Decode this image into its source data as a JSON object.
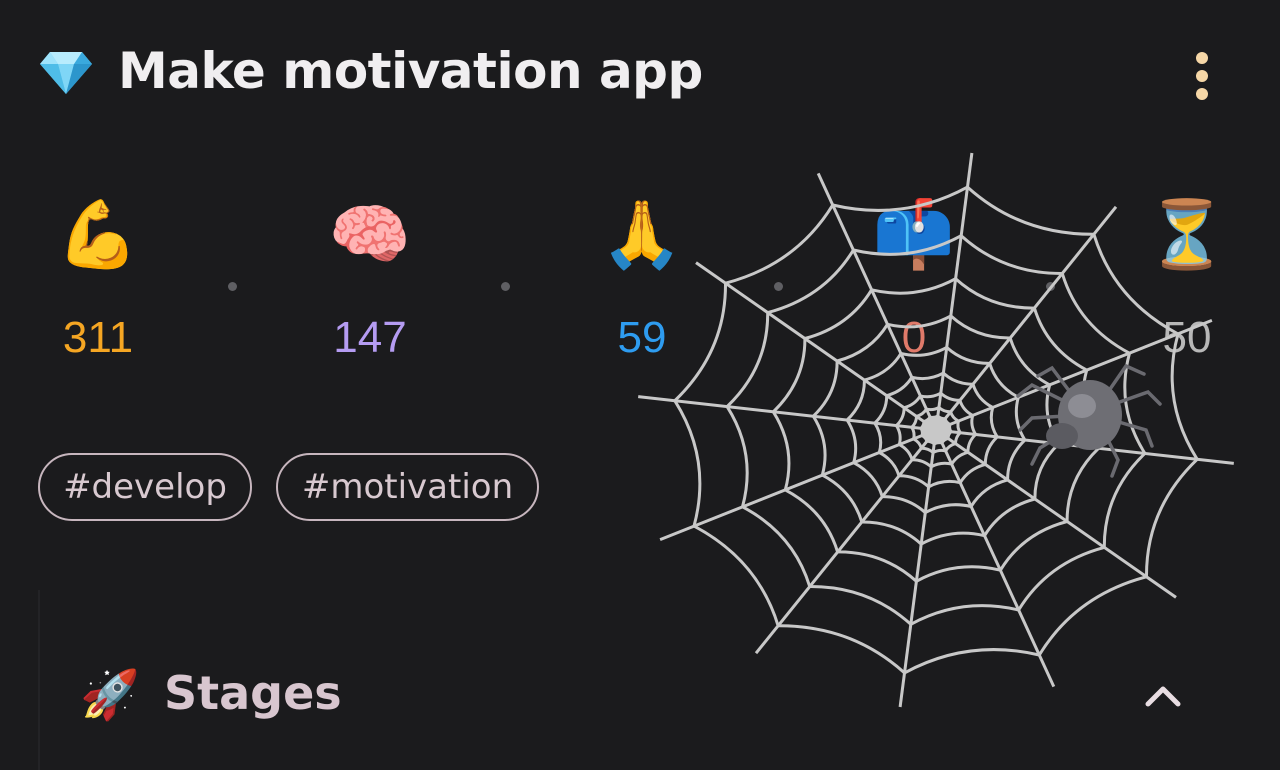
{
  "header": {
    "title": "Make motivation app",
    "title_icon": "gem-icon",
    "menu_icon": "more-vertical-icon"
  },
  "stats": [
    {
      "emoji": "💪",
      "icon": "flexed-biceps-icon",
      "value": "311",
      "color": "#f5a623"
    },
    {
      "emoji": "🧠",
      "icon": "brain-icon",
      "value": "147",
      "color": "#b59cf2"
    },
    {
      "emoji": "🙏",
      "icon": "folded-hands-icon",
      "value": "59",
      "color": "#2e9cf0"
    },
    {
      "emoji": "📫",
      "icon": "mailbox-icon",
      "value": "0",
      "color": "#e07a6a"
    },
    {
      "emoji": "⏳",
      "icon": "hourglass-icon",
      "value": "50",
      "color": "#b8b8b8"
    }
  ],
  "tags": [
    "#develop",
    "#motivation"
  ],
  "stages": {
    "label": "Stages",
    "icon": "rocket-icon",
    "emoji": "🚀",
    "collapse_icon": "chevron-up-icon"
  },
  "overlay": {
    "web_icon": "spider-web-icon",
    "spider_icon": "spider-icon"
  },
  "colors": {
    "background": "#1b1b1d",
    "menu_dots": "#f6d7a7",
    "tag_border": "#c7b6be",
    "web": "#c8c8c8"
  }
}
